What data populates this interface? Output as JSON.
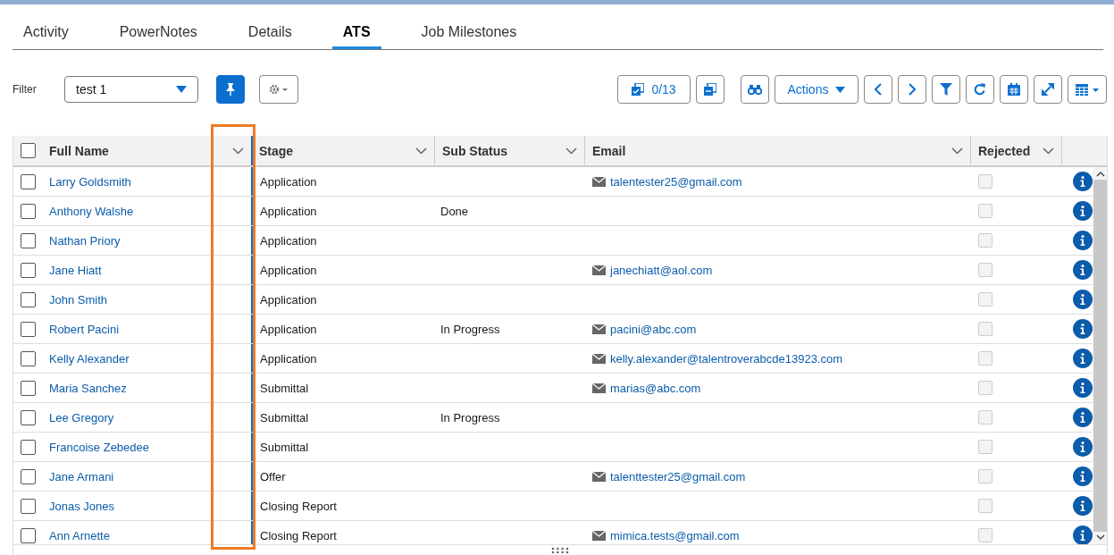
{
  "tabs": [
    {
      "label": "Activity",
      "selected": false
    },
    {
      "label": "PowerNotes",
      "selected": false
    },
    {
      "label": "Details",
      "selected": false
    },
    {
      "label": "ATS",
      "selected": true
    },
    {
      "label": "Job Milestones",
      "selected": false
    }
  ],
  "filter": {
    "label": "Filter",
    "value": "test 1"
  },
  "toolbar": {
    "selection_count": "0/13",
    "actions_label": "Actions"
  },
  "table": {
    "all_checked": false,
    "columns": [
      "Full Name",
      "Stage",
      "Sub Status",
      "Email",
      "Rejected"
    ],
    "rows": [
      {
        "checked": false,
        "name": "Larry Goldsmith",
        "stage": "Application",
        "email": "talentester25@gmail.com",
        "rejected": false
      },
      {
        "checked": false,
        "name": "Anthony Walshe",
        "stage": "Application",
        "sub_status": "Done",
        "rejected": false
      },
      {
        "checked": false,
        "name": "Nathan Priory",
        "stage": "Application",
        "rejected": false
      },
      {
        "checked": false,
        "name": "Jane Hiatt",
        "stage": "Application",
        "email": "janechiatt@aol.com",
        "rejected": false
      },
      {
        "checked": false,
        "name": "John Smith",
        "stage": "Application",
        "rejected": false
      },
      {
        "checked": false,
        "name": "Robert Pacini",
        "stage": "Application",
        "sub_status": "In Progress",
        "email": "pacini@abc.com",
        "rejected": false
      },
      {
        "checked": false,
        "name": "Kelly Alexander",
        "stage": "Application",
        "email": "kelly.alexander@talentroverabcde13923.com",
        "rejected": false
      },
      {
        "checked": false,
        "name": "Maria Sanchez",
        "stage": "Submittal",
        "email": "marias@abc.com",
        "rejected": false
      },
      {
        "checked": false,
        "name": "Lee Gregory",
        "stage": "Submittal",
        "sub_status": "In Progress",
        "rejected": false
      },
      {
        "checked": false,
        "name": "Francoise Zebedee",
        "stage": "Submittal",
        "rejected": false
      },
      {
        "checked": false,
        "name": "Jane Armani",
        "stage": "Offer",
        "email": "talenttester25@gmail.com",
        "rejected": false
      },
      {
        "checked": false,
        "name": "Jonas Jones",
        "stage": "Closing Report",
        "rejected": false
      },
      {
        "checked": false,
        "name": "Ann Arnette",
        "stage": "Closing Report",
        "email": "mimica.tests@gmail.com",
        "rejected": false
      }
    ]
  }
}
